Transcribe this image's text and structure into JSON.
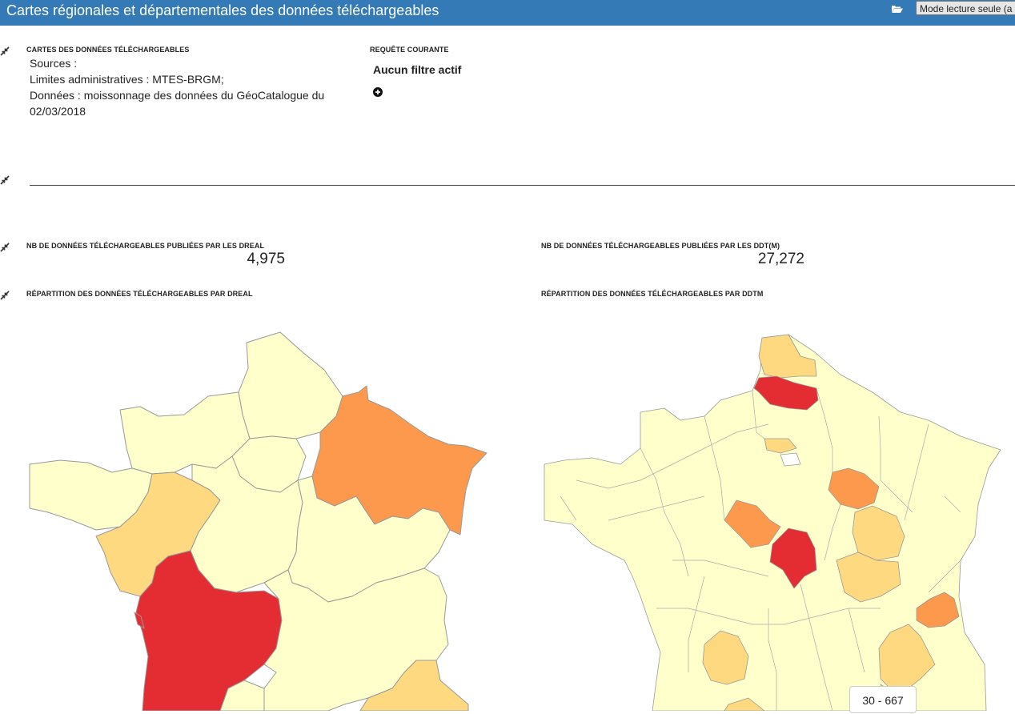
{
  "header": {
    "title": "Cartes régionales et départementales des données téléchargeables",
    "readonly_button": "Mode lecture seule (a",
    "folder_icon": "folder-open-icon"
  },
  "sources": {
    "title": "CARTES DES DONNÉES TÉLÉCHARGEABLES",
    "lines": [
      "Sources :",
      "Limites administratives : MTES-BRGM;",
      "Données : moissonnage des données du GéoCatalogue du",
      "02/03/2018"
    ]
  },
  "request": {
    "title": "REQUÊTE COURANTE",
    "status": "Aucun filtre actif",
    "add_icon": "plus-circle-icon"
  },
  "kpis": {
    "dreal": {
      "title": "NB DE DONNÉES TÉLÉCHARGEABLES PUBLIÉES PAR LES DREAL",
      "value": "4,975"
    },
    "ddt": {
      "title": "NB DE DONNÉES TÉLÉCHARGEABLES PUBLIÉES PAR LES DDT(M)",
      "value": "27,272"
    }
  },
  "maps": {
    "dreal": {
      "title": "RÉPARTITION DES DONNÉES TÉLÉCHARGEABLES PAR DREAL"
    },
    "ddtm": {
      "title": "RÉPARTITION DES DONNÉES TÉLÉCHARGEABLES PAR DDTM",
      "legend": "30 - 667"
    }
  },
  "colors": {
    "header": "#337ab7",
    "low": "#ffffcc",
    "mid_low": "#fed976",
    "mid_high": "#fd8d3c",
    "high": "#e31a1c",
    "border": "#999999"
  }
}
